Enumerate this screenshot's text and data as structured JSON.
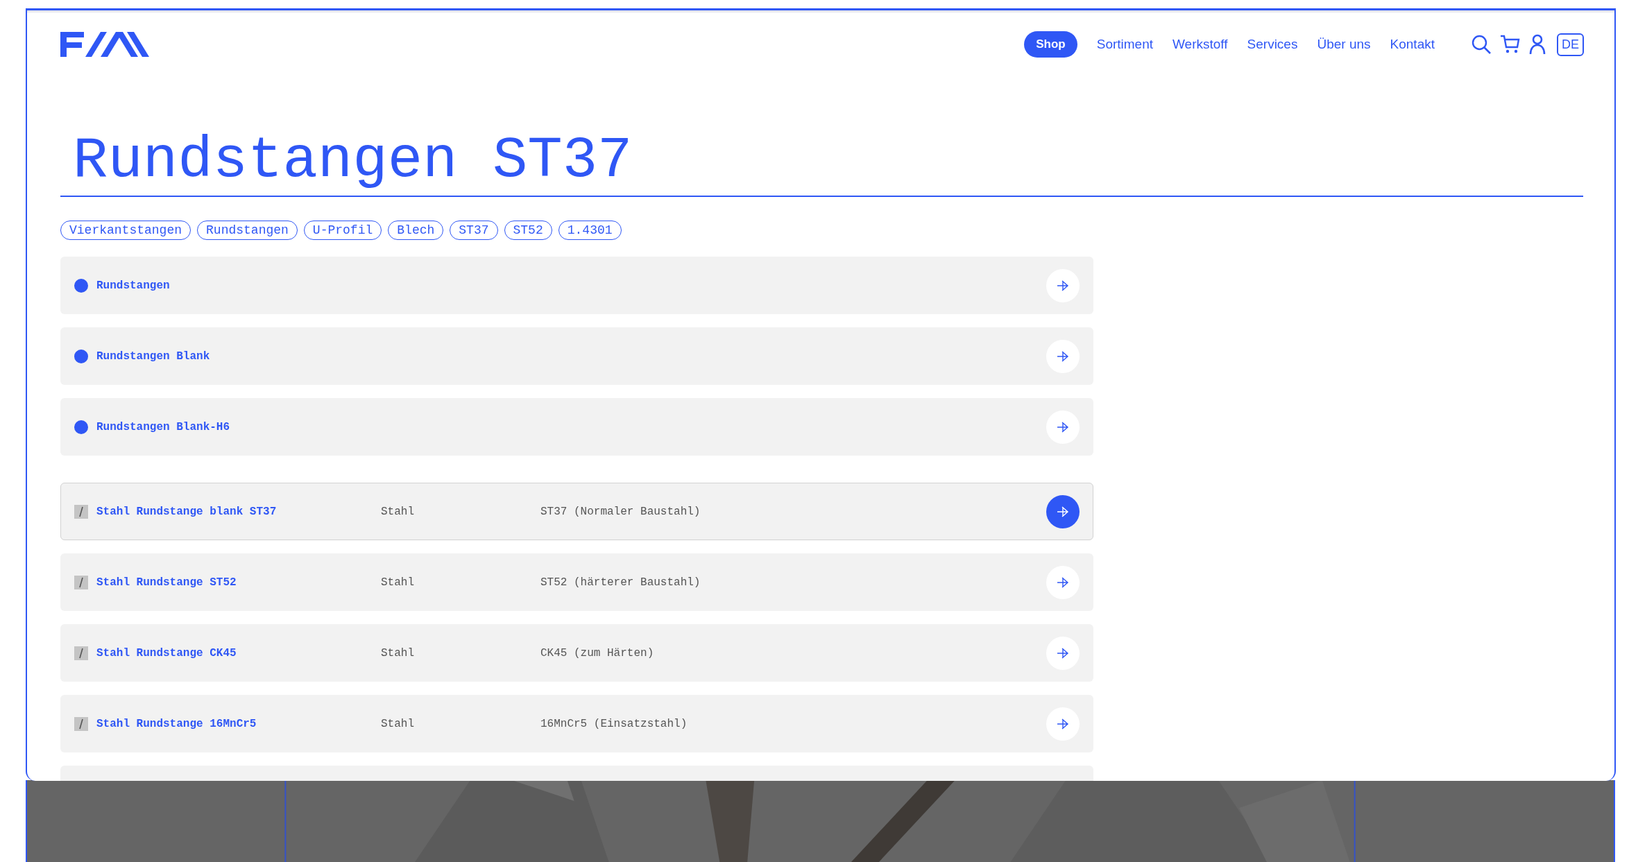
{
  "nav": {
    "items": [
      {
        "label": "Shop",
        "selected": true
      },
      {
        "label": "Sortiment",
        "selected": false
      },
      {
        "label": "Werkstoff",
        "selected": false
      },
      {
        "label": "Services",
        "selected": false
      },
      {
        "label": "Über uns",
        "selected": false
      },
      {
        "label": "Kontakt",
        "selected": false
      }
    ],
    "language": "DE"
  },
  "title": "Rundstangen ST37",
  "tags": [
    "Vierkantstangen",
    "Rundstangen",
    "U-Profil",
    "Blech",
    "ST37",
    "ST52",
    "1.4301"
  ],
  "categories": [
    {
      "name": "Rundstangen"
    },
    {
      "name": "Rundstangen Blank"
    },
    {
      "name": "Rundstangen Blank-H6"
    }
  ],
  "products": [
    {
      "name": "Stahl Rundstange blank ST37",
      "material": "Stahl",
      "grade": "ST37 (Normaler Baustahl)",
      "highlighted": true
    },
    {
      "name": "Stahl Rundstange ST52",
      "material": "Stahl",
      "grade": "ST52 (härterer Baustahl)",
      "highlighted": false
    },
    {
      "name": "Stahl Rundstange CK45",
      "material": "Stahl",
      "grade": "CK45 (zum Härten)",
      "highlighted": false
    },
    {
      "name": "Stahl Rundstange 16MnCr5",
      "material": "Stahl",
      "grade": "16MnCr5 (Einsatzstahl)",
      "highlighted": false
    }
  ]
}
